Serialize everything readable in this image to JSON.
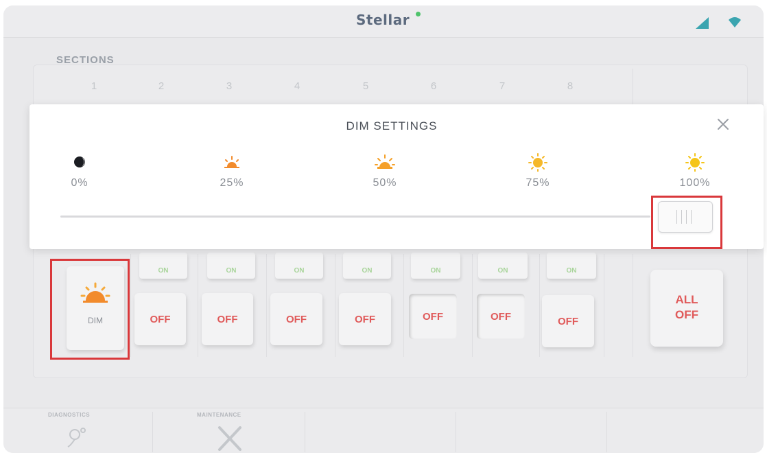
{
  "app": {
    "title": "Stellar"
  },
  "status_icons": [
    "signal-icon",
    "wifi-icon"
  ],
  "sections": {
    "label": "SECTIONS",
    "numbers": [
      "1",
      "2",
      "3",
      "4",
      "5",
      "6",
      "7",
      "8"
    ],
    "dim_button_label": "DIM",
    "off_label": "OFF",
    "on_label": "ON",
    "all_off_line1": "ALL",
    "all_off_line2": "OFF"
  },
  "dim_settings": {
    "title": "DIM SETTINGS",
    "levels": [
      {
        "label": "0%",
        "icon": "moon-icon"
      },
      {
        "label": "25%",
        "icon": "sun-25-icon"
      },
      {
        "label": "50%",
        "icon": "sun-50-icon"
      },
      {
        "label": "75%",
        "icon": "sun-75-icon"
      },
      {
        "label": "100%",
        "icon": "sun-100-icon"
      }
    ],
    "slider_value_percent": 100
  },
  "bottom_nav": [
    {
      "label": "DIAGNOSTICS",
      "icon": "diagnostics-icon"
    },
    {
      "label": "MAINTENANCE",
      "icon": "wrench-icon"
    }
  ],
  "colors": {
    "accent_red": "#e05a5a",
    "highlight": "#d9383b",
    "sun_orange": "#f28b2c",
    "sun_yellow": "#f5c518"
  }
}
